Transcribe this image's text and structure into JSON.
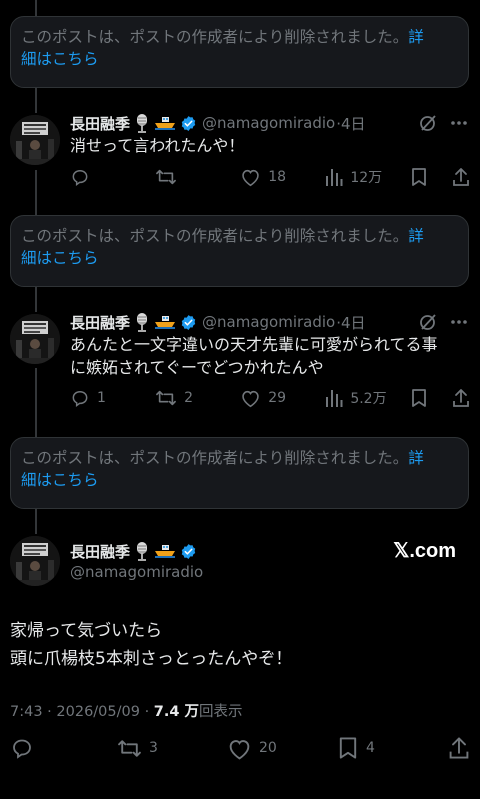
{
  "deleted_notice": {
    "text": "このポストは、ポストの作成者により削除されました。",
    "link": "詳",
    "link2": "細はこちら"
  },
  "author": {
    "name": "長田融季",
    "handle": "@namagomiradio"
  },
  "reply1": {
    "meta": "·4日",
    "text": "消せって言われたんや！",
    "replies": "",
    "reposts": "",
    "likes": "18",
    "views": "12万"
  },
  "reply2": {
    "meta": "·4日",
    "text_line1": "あんたと一文字違いの天才先輩に可愛がられてる事",
    "text_line2": "に嫉妬されてぐーでどつかれたんや",
    "replies": "1",
    "reposts": "2",
    "likes": "29",
    "views": "5.2万"
  },
  "main": {
    "watermark": "𝕏.com",
    "text_line1": "家帰って気づいたら",
    "text_line2": "頭に爪楊枝5本刺さっとったんやぞ！",
    "time": "7:43 · 2026/05/09 · ",
    "views_bold": "7.4 万",
    "views_suffix": "回表示",
    "replies": "",
    "reposts": "3",
    "likes": "20",
    "bookmarks": "4"
  },
  "colors": {
    "background": "#000000",
    "text": "#e7e9ea",
    "muted": "#71767b",
    "link": "#1d9bf0",
    "verified": "#1d9bf0"
  },
  "icons": [
    "mic-emoji-icon",
    "boat-emoji-icon",
    "verified-badge-icon",
    "grok-icon",
    "more-icon",
    "reply-icon",
    "repost-icon",
    "like-icon",
    "views-icon",
    "bookmark-icon",
    "share-icon"
  ]
}
